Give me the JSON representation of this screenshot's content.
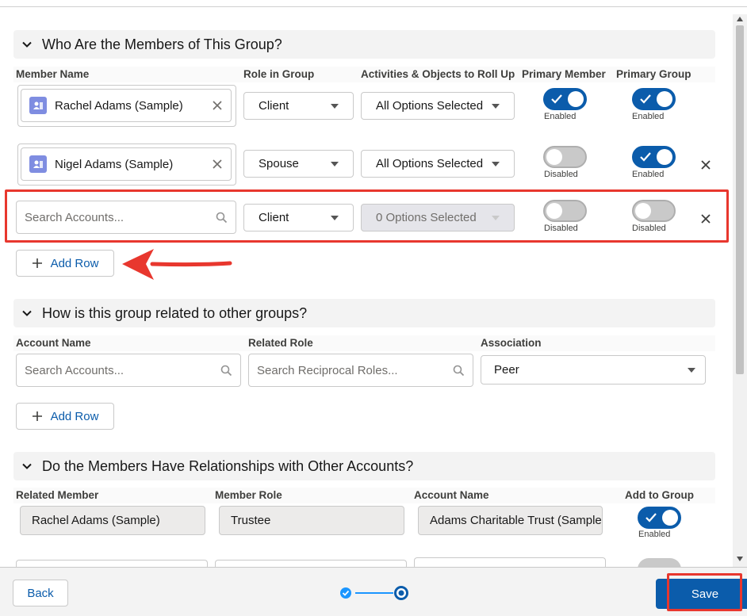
{
  "sections": {
    "members": {
      "title": "Who Are the Members of This Group?",
      "columns": {
        "member_name": "Member Name",
        "role_in_group": "Role in Group",
        "rollup": "Activities & Objects to Roll Up",
        "primary_member": "Primary Member",
        "primary_group": "Primary Group"
      },
      "rows": [
        {
          "member": "Rachel Adams (Sample)",
          "role": "Client",
          "rollup": "All Options Selected",
          "primary_member": "Enabled",
          "primary_group": "Enabled"
        },
        {
          "member": "Nigel Adams (Sample)",
          "role": "Spouse",
          "rollup": "All Options Selected",
          "primary_member": "Disabled",
          "primary_group": "Enabled"
        },
        {
          "member_placeholder": "Search Accounts...",
          "role": "Client",
          "rollup": "0 Options Selected",
          "primary_member": "Disabled",
          "primary_group": "Disabled"
        }
      ],
      "add_row_label": "Add Row"
    },
    "related_groups": {
      "title": "How is this group related to other groups?",
      "columns": {
        "account_name": "Account Name",
        "related_role": "Related Role",
        "association": "Association"
      },
      "row": {
        "account_placeholder": "Search Accounts...",
        "role_placeholder": "Search Reciprocal Roles...",
        "association": "Peer"
      },
      "add_row_label": "Add Row"
    },
    "relationships": {
      "title": "Do the Members Have Relationships with Other Accounts?",
      "columns": {
        "related_member": "Related Member",
        "member_role": "Member Role",
        "account_name": "Account Name",
        "add_to_group": "Add to Group"
      },
      "rows": [
        {
          "related_member": "Rachel Adams (Sample)",
          "member_role": "Trustee",
          "account_name": "Adams Charitable Trust (Sample)",
          "add_to_group": "Enabled"
        }
      ]
    }
  },
  "footer": {
    "back_label": "Back",
    "save_label": "Save",
    "progress": {
      "steps": 2,
      "current": 2
    }
  },
  "colors": {
    "brand": "#0b5cab",
    "annotation_red": "#e8372e",
    "section_bg": "#f3f3f3"
  }
}
